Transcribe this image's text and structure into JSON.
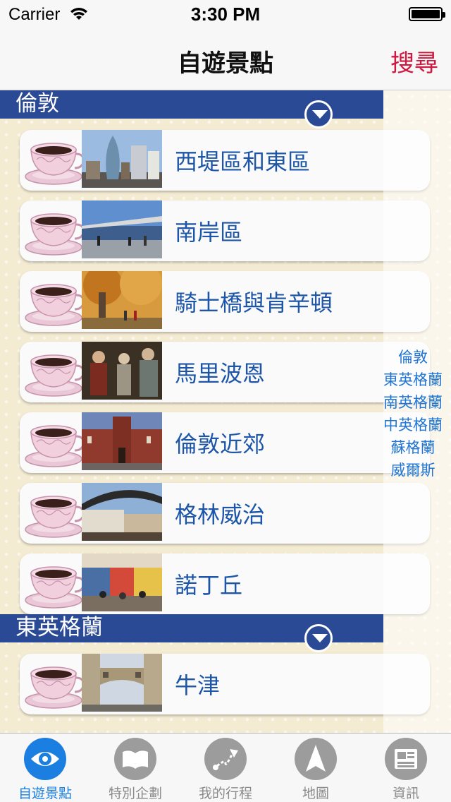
{
  "status_bar": {
    "carrier": "Carrier",
    "time": "3:30 PM"
  },
  "nav": {
    "title": "自遊景點",
    "search_label": "搜尋"
  },
  "sections": [
    {
      "title": "倫敦",
      "items": [
        {
          "label": "西堤區和東區",
          "thumb": "city-skyline-photo"
        },
        {
          "label": "南岸區",
          "thumb": "millennium-bridge-photo"
        },
        {
          "label": "騎士橋與肯辛頓",
          "thumb": "autumn-park-photo"
        },
        {
          "label": "馬里波恩",
          "thumb": "wax-figures-photo"
        },
        {
          "label": "倫敦近郊",
          "thumb": "brick-palace-photo"
        },
        {
          "label": "格林威治",
          "thumb": "market-arch-photo"
        },
        {
          "label": "諾丁丘",
          "thumb": "street-market-photo"
        }
      ]
    },
    {
      "title": "東英格蘭",
      "items": [
        {
          "label": "牛津",
          "thumb": "bridge-of-sighs-photo"
        }
      ]
    }
  ],
  "index": [
    "倫敦",
    "東英格蘭",
    "南英格蘭",
    "中英格蘭",
    "蘇格蘭",
    "威爾斯"
  ],
  "tabs": [
    {
      "label": "自遊景點",
      "icon": "eye-icon",
      "active": true
    },
    {
      "label": "特別企劃",
      "icon": "book-icon",
      "active": false
    },
    {
      "label": "我的行程",
      "icon": "route-icon",
      "active": false
    },
    {
      "label": "地圖",
      "icon": "compass-arrow-icon",
      "active": false
    },
    {
      "label": "資訊",
      "icon": "newspaper-icon",
      "active": false
    }
  ],
  "colors": {
    "accent": "#1a7fe0",
    "section": "#2b4a95",
    "search": "#d0173f",
    "item_text": "#1d56a8"
  }
}
